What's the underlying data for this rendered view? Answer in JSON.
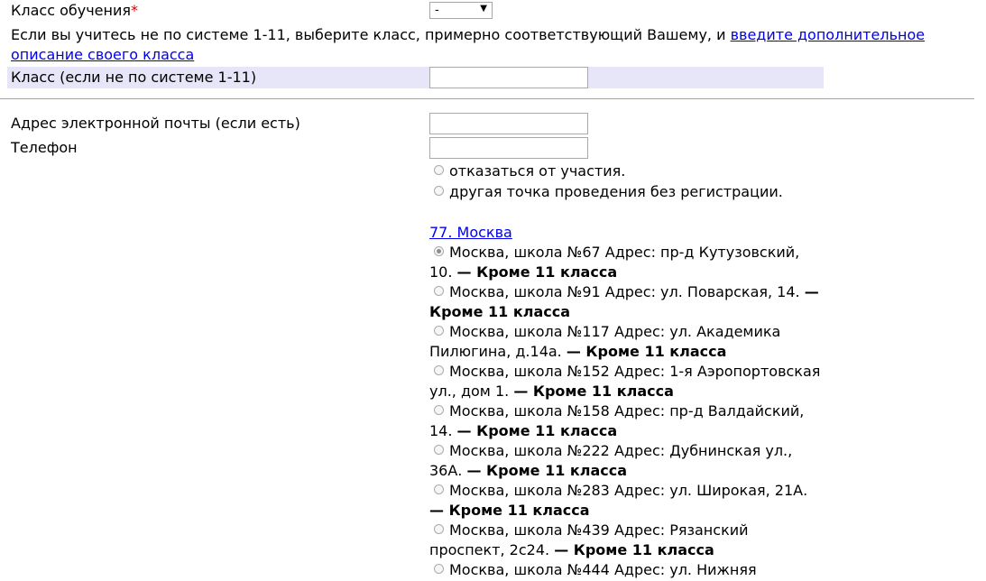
{
  "form": {
    "class_label": "Класс обучения",
    "required_mark": "*",
    "class_select_value": "-",
    "class_select_arrow": "▼",
    "note_text": "Если вы учитесь не по системе 1-11, выберите класс, примерно соответствующий Вашему, и ",
    "note_link": "введите дополнительное описание своего класса",
    "custom_class_label": "Класс (если не по системе 1-11)",
    "custom_class_value": "",
    "email_label": "Адрес электронной почты (если есть)",
    "email_value": "",
    "phone_label": "Телефон",
    "phone_value": ""
  },
  "options": {
    "decline": "отказаться от участия.",
    "other_point": "другая точка проведения без регистрации."
  },
  "region": {
    "link": "77. Москва"
  },
  "schools": [
    {
      "text": "Москва, школа №67 Адрес: пр-д Кутузовский, 10.",
      "note": "— Кроме 11 класса",
      "checked": true
    },
    {
      "text": "Москва, школа №91 Адрес: ул. Поварская, 14.",
      "note": "— Кроме 11 класса",
      "checked": false
    },
    {
      "text": "Москва, школа №117 Адрес: ул. Академика Пилюгина, д.14а.",
      "note": "— Кроме 11 класса",
      "checked": false
    },
    {
      "text": "Москва, школа №152 Адрес: 1-я Аэропортовская ул., дом 1.",
      "note": "— Кроме 11 класса",
      "checked": false
    },
    {
      "text": "Москва, школа №158 Адрес: пр-д Валдайский, 14.",
      "note": "— Кроме 11 класса",
      "checked": false
    },
    {
      "text": "Москва, школа №222 Адрес: Дубнинская ул., 36А.",
      "note": "— Кроме 11 класса",
      "checked": false
    },
    {
      "text": "Москва, школа №283 Адрес: ул. Широкая, 21А.",
      "note": "— Кроме 11 класса",
      "checked": false
    },
    {
      "text": "Москва, школа №439 Адрес: Рязанский проспект, 2с24.",
      "note": "— Кроме 11 класса",
      "checked": false
    },
    {
      "text": "Москва, школа №444 Адрес: ул. Нижняя",
      "note": "",
      "checked": false
    }
  ]
}
